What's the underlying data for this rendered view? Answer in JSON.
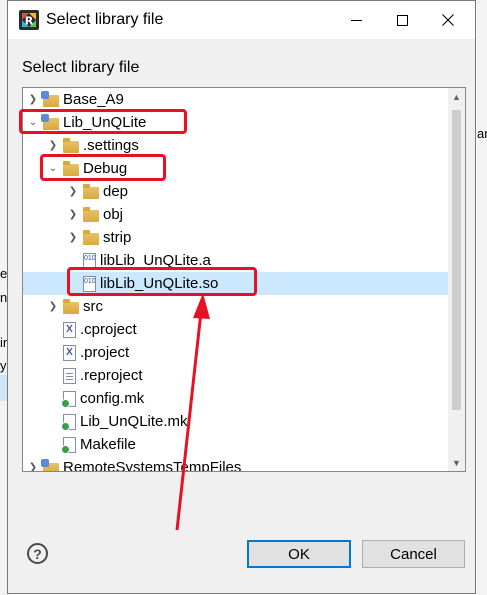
{
  "window": {
    "title": "Select library file",
    "app_icon": "rvds-app-icon"
  },
  "dialog": {
    "label": "Select library file"
  },
  "tree": {
    "items": [
      {
        "label": "Base_A9",
        "icon": "project-folder-icon",
        "twisty": "collapsed"
      },
      {
        "label": "Lib_UnQLite",
        "icon": "project-folder-icon",
        "twisty": "expanded"
      },
      {
        "label": ".settings",
        "icon": "folder-icon",
        "twisty": "collapsed"
      },
      {
        "label": "Debug",
        "icon": "folder-icon",
        "twisty": "expanded"
      },
      {
        "label": "dep",
        "icon": "folder-icon",
        "twisty": "collapsed"
      },
      {
        "label": "obj",
        "icon": "folder-icon",
        "twisty": "collapsed"
      },
      {
        "label": "strip",
        "icon": "folder-icon",
        "twisty": "collapsed"
      },
      {
        "label": "libLib_UnQLite.a",
        "icon": "binary-file-icon",
        "twisty": "none"
      },
      {
        "label": "libLib_UnQLite.so",
        "icon": "binary-file-icon",
        "twisty": "none",
        "selected": true
      },
      {
        "label": "src",
        "icon": "folder-icon",
        "twisty": "collapsed"
      },
      {
        "label": ".cproject",
        "icon": "xml-file-icon",
        "twisty": "none"
      },
      {
        "label": ".project",
        "icon": "xml-file-icon",
        "twisty": "none"
      },
      {
        "label": ".reproject",
        "icon": "text-file-icon",
        "twisty": "none"
      },
      {
        "label": "config.mk",
        "icon": "makefile-icon",
        "twisty": "none"
      },
      {
        "label": "Lib_UnQLite.mk",
        "icon": "makefile-icon",
        "twisty": "none"
      },
      {
        "label": "Makefile",
        "icon": "makefile-icon",
        "twisty": "none"
      },
      {
        "label": "RemoteSystemsTempFiles",
        "icon": "project-folder-icon",
        "twisty": "collapsed"
      }
    ],
    "binary_glyph": "010"
  },
  "buttons": {
    "help": "?",
    "ok": "OK",
    "cancel": "Cancel"
  },
  "background": {
    "left_chars": [
      "e",
      "n",
      "in",
      "y"
    ],
    "right_chars": [
      "ar"
    ]
  },
  "colors": {
    "annotation_red": "#e81123",
    "selection": "#cce8ff",
    "default_button_border": "#0078d7"
  }
}
